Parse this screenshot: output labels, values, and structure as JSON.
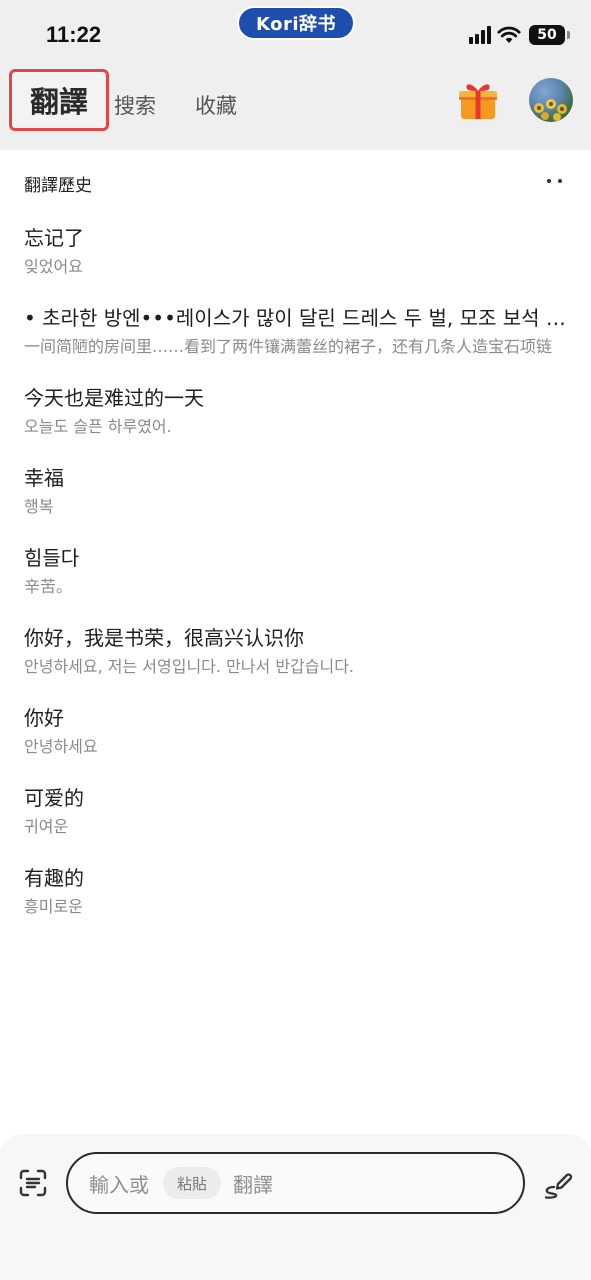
{
  "status_bar": {
    "time": "11:22",
    "app_name": "Kori辞书",
    "battery": "50"
  },
  "tabs": [
    {
      "label": "翻譯",
      "active": true
    },
    {
      "label": "搜索",
      "active": false
    },
    {
      "label": "收藏",
      "active": false
    }
  ],
  "header_icons": [
    "gift-icon",
    "avatar"
  ],
  "history": {
    "title": "翻譯歷史",
    "items": [
      {
        "source": "忘记了",
        "target": "잊었어요"
      },
      {
        "source": "• 초라한 방엔•••레이스가 많이 달린 드레스 두 벌, 모조 보석 목걸이",
        "target": "一间简陋的房间里……看到了两件镶满蕾丝的裙子，还有几条人造宝石项链"
      },
      {
        "source": "今天也是难过的一天",
        "target": "오늘도 슬픈 하루였어."
      },
      {
        "source": "幸福",
        "target": "행복"
      },
      {
        "source": "힘들다",
        "target": "辛苦。"
      },
      {
        "source": "你好，我是书荣，很高兴认识你",
        "target": "안녕하세요, 저는 서영입니다. 만나서 반갑습니다."
      },
      {
        "source": "你好",
        "target": "안녕하세요"
      },
      {
        "source": "可爱的",
        "target": "귀여운"
      },
      {
        "source": "有趣的",
        "target": "흥미로운"
      }
    ]
  },
  "input_bar": {
    "prefix": "輸入或",
    "paste_label": "粘貼",
    "suffix": "翻譯"
  },
  "colors": {
    "header_bg": "#efefef",
    "active_tab_border": "#e04848",
    "app_pill": "#1f4fae"
  }
}
